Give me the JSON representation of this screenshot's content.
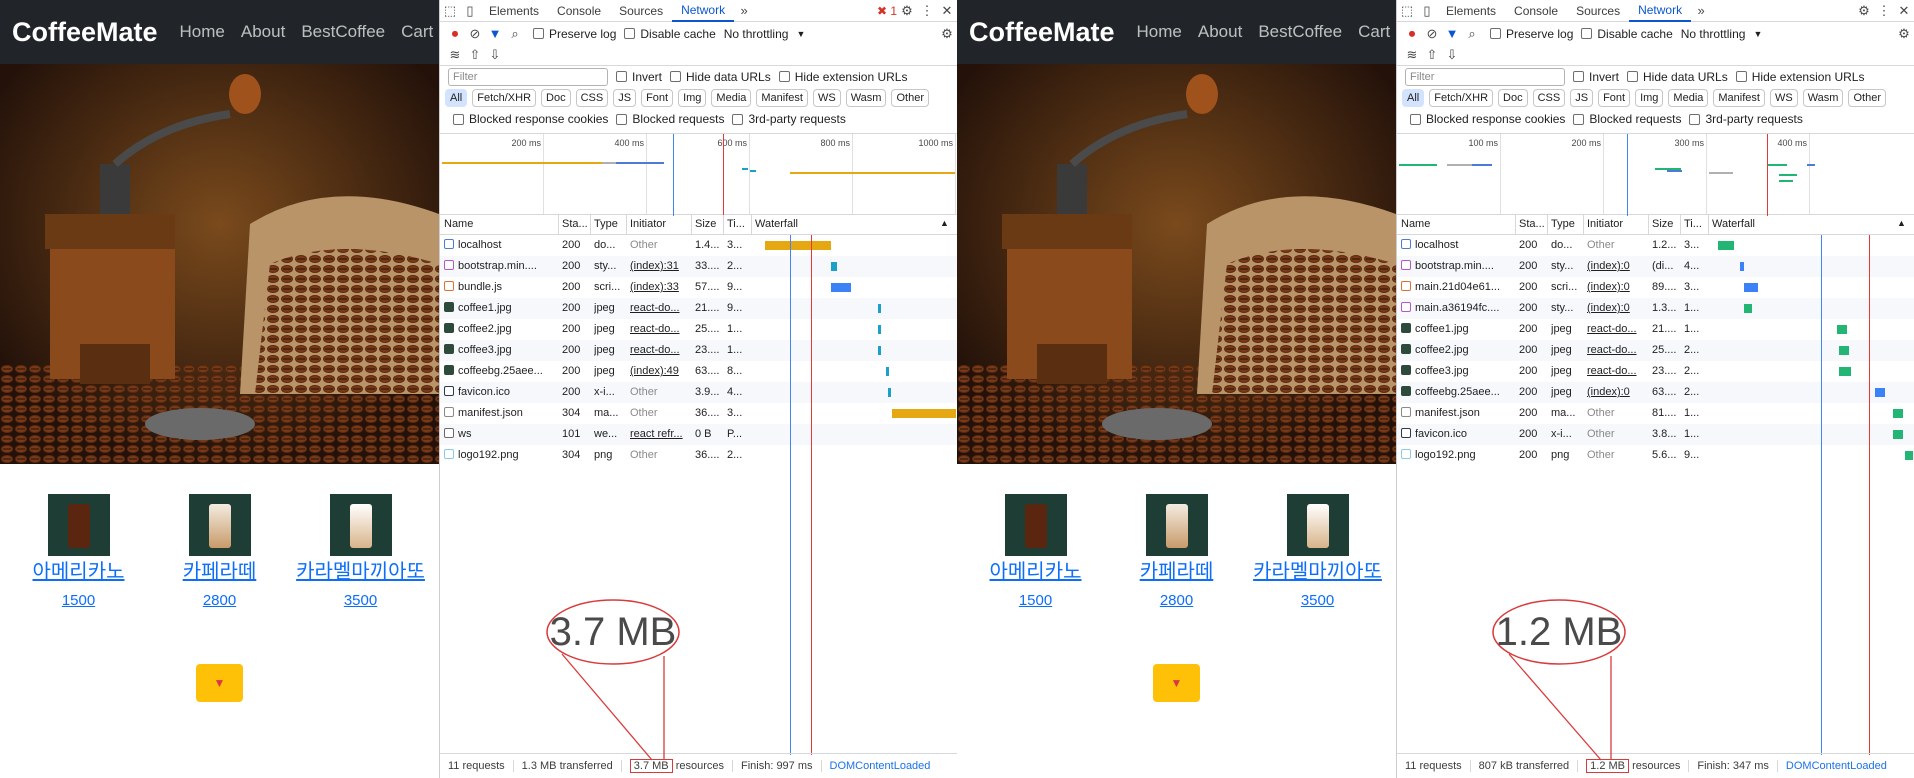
{
  "left": {
    "app": {
      "brand": "CoffeeMate",
      "nav": [
        "Home",
        "About",
        "BestCoffee",
        "Cart"
      ],
      "products": [
        {
          "name": "아메리카노",
          "price": "1500"
        },
        {
          "name": "카페라떼",
          "price": "2800"
        },
        {
          "name": "카라멜마끼아또",
          "price": "3500"
        }
      ]
    },
    "devtools": {
      "tabs": [
        "Elements",
        "Console",
        "Sources",
        "Network"
      ],
      "error_count": "1",
      "preserve_log": "Preserve log",
      "disable_cache": "Disable cache",
      "throttling": "No throttling",
      "filter_placeholder": "Filter",
      "invert": "Invert",
      "hide_data_urls": "Hide data URLs",
      "hide_ext_urls": "Hide extension URLs",
      "types": [
        "All",
        "Fetch/XHR",
        "Doc",
        "CSS",
        "JS",
        "Font",
        "Img",
        "Media",
        "Manifest",
        "WS",
        "Wasm",
        "Other"
      ],
      "blocked_cookies": "Blocked response cookies",
      "blocked_requests": "Blocked requests",
      "third_party": "3rd-party requests",
      "ticks": [
        "200 ms",
        "400 ms",
        "600 ms",
        "800 ms",
        "1000 ms"
      ],
      "columns": [
        "Name",
        "Sta...",
        "Type",
        "Initiator",
        "Size",
        "Ti...",
        "Waterfall"
      ],
      "rows": [
        {
          "icon": "doc",
          "name": "localhost",
          "status": "200",
          "type": "do...",
          "initiator": "Other",
          "init_link": false,
          "size": "1.4...",
          "time": "3...",
          "wf_start": 0.05,
          "wf_len": 0.33,
          "wf_color": "#e5a812"
        },
        {
          "icon": "css",
          "name": "bootstrap.min....",
          "status": "200",
          "type": "sty...",
          "initiator": "(index):31",
          "init_link": true,
          "size": "33....",
          "time": "2...",
          "wf_start": 0.38,
          "wf_len": 0.03,
          "wf_color": "#1ba0c9"
        },
        {
          "icon": "js",
          "name": "bundle.js",
          "status": "200",
          "type": "scri...",
          "initiator": "(index):33",
          "init_link": true,
          "size": "57....",
          "time": "9...",
          "wf_start": 0.38,
          "wf_len": 0.1,
          "wf_color": "#3b82f6"
        },
        {
          "icon": "img",
          "name": "coffee1.jpg",
          "status": "200",
          "type": "jpeg",
          "initiator": "react-do...",
          "init_link": true,
          "size": "21....",
          "time": "9...",
          "wf_start": 0.61,
          "wf_len": 0.015,
          "wf_color": "#1ba0c9"
        },
        {
          "icon": "img",
          "name": "coffee2.jpg",
          "status": "200",
          "type": "jpeg",
          "initiator": "react-do...",
          "init_link": true,
          "size": "25....",
          "time": "1...",
          "wf_start": 0.61,
          "wf_len": 0.015,
          "wf_color": "#1ba0c9"
        },
        {
          "icon": "img",
          "name": "coffee3.jpg",
          "status": "200",
          "type": "jpeg",
          "initiator": "react-do...",
          "init_link": true,
          "size": "23....",
          "time": "1...",
          "wf_start": 0.61,
          "wf_len": 0.015,
          "wf_color": "#1ba0c9"
        },
        {
          "icon": "img",
          "name": "coffeebg.25aee...",
          "status": "200",
          "type": "jpeg",
          "initiator": "(index):49",
          "init_link": true,
          "size": "63....",
          "time": "8...",
          "wf_start": 0.65,
          "wf_len": 0.015,
          "wf_color": "#1ba0c9"
        },
        {
          "icon": "ico",
          "name": "favicon.ico",
          "status": "200",
          "type": "x-i...",
          "initiator": "Other",
          "init_link": false,
          "size": "3.9...",
          "time": "4...",
          "wf_start": 0.66,
          "wf_len": 0.015,
          "wf_color": "#1ba0c9"
        },
        {
          "icon": "man",
          "name": "manifest.json",
          "status": "304",
          "type": "ma...",
          "initiator": "Other",
          "init_link": false,
          "size": "36....",
          "time": "3...",
          "wf_start": 0.68,
          "wf_len": 0.32,
          "wf_color": "#e5a812"
        },
        {
          "icon": "ws",
          "name": "ws",
          "status": "101",
          "type": "we...",
          "initiator": "react refr...",
          "init_link": true,
          "size": "0 B",
          "time": "P...",
          "wf_start": 0,
          "wf_len": 0,
          "wf_color": "#e5a812"
        },
        {
          "icon": "png",
          "name": "logo192.png",
          "status": "304",
          "type": "png",
          "initiator": "Other",
          "init_link": false,
          "size": "36....",
          "time": "2...",
          "wf_start": 0,
          "wf_len": 0,
          "wf_color": "#e5a812"
        }
      ],
      "requests": "11 requests",
      "transferred": "1.3 MB transferred",
      "resources_value": "3.7 MB",
      "resources_label": "resources",
      "finish": "Finish: 997 ms",
      "dcl": "DOMContentLoaded",
      "callout": "3.7 MB"
    }
  },
  "right": {
    "app": {
      "brand": "CoffeeMate",
      "nav": [
        "Home",
        "About",
        "BestCoffee",
        "Cart"
      ],
      "products": [
        {
          "name": "아메리카노",
          "price": "1500"
        },
        {
          "name": "카페라떼",
          "price": "2800"
        },
        {
          "name": "카라멜마끼아또",
          "price": "3500"
        }
      ]
    },
    "devtools": {
      "tabs": [
        "Elements",
        "Console",
        "Sources",
        "Network"
      ],
      "preserve_log": "Preserve log",
      "disable_cache": "Disable cache",
      "throttling": "No throttling",
      "filter_placeholder": "Filter",
      "invert": "Invert",
      "hide_data_urls": "Hide data URLs",
      "hide_ext_urls": "Hide extension URLs",
      "types": [
        "All",
        "Fetch/XHR",
        "Doc",
        "CSS",
        "JS",
        "Font",
        "Img",
        "Media",
        "Manifest",
        "WS",
        "Wasm",
        "Other"
      ],
      "blocked_cookies": "Blocked response cookies",
      "blocked_requests": "Blocked requests",
      "third_party": "3rd-party requests",
      "ticks": [
        "100 ms",
        "200 ms",
        "300 ms",
        "400 ms"
      ],
      "columns": [
        "Name",
        "Sta...",
        "Type",
        "Initiator",
        "Size",
        "Ti...",
        "Waterfall"
      ],
      "rows": [
        {
          "icon": "doc",
          "name": "localhost",
          "status": "200",
          "type": "do...",
          "initiator": "Other",
          "init_link": false,
          "size": "1.2...",
          "time": "3...",
          "wf_start": 0.03,
          "wf_len": 0.08,
          "wf_color": "#22b573"
        },
        {
          "icon": "css",
          "name": "bootstrap.min....",
          "status": "200",
          "type": "sty...",
          "initiator": "(index):0",
          "init_link": true,
          "size": "(di...",
          "time": "4...",
          "wf_start": 0.14,
          "wf_len": 0.02,
          "wf_color": "#3b82f6"
        },
        {
          "icon": "js",
          "name": "main.21d04e61...",
          "status": "200",
          "type": "scri...",
          "initiator": "(index):0",
          "init_link": true,
          "size": "89....",
          "time": "3...",
          "wf_start": 0.16,
          "wf_len": 0.07,
          "wf_color": "#3b82f6"
        },
        {
          "icon": "css",
          "name": "main.a36194fc....",
          "status": "200",
          "type": "sty...",
          "initiator": "(index):0",
          "init_link": true,
          "size": "1.3...",
          "time": "1...",
          "wf_start": 0.16,
          "wf_len": 0.04,
          "wf_color": "#22b573"
        },
        {
          "icon": "img",
          "name": "coffee1.jpg",
          "status": "200",
          "type": "jpeg",
          "initiator": "react-do...",
          "init_link": true,
          "size": "21....",
          "time": "1...",
          "wf_start": 0.62,
          "wf_len": 0.05,
          "wf_color": "#22b573"
        },
        {
          "icon": "img",
          "name": "coffee2.jpg",
          "status": "200",
          "type": "jpeg",
          "initiator": "react-do...",
          "init_link": true,
          "size": "25....",
          "time": "2...",
          "wf_start": 0.63,
          "wf_len": 0.05,
          "wf_color": "#22b573"
        },
        {
          "icon": "img",
          "name": "coffee3.jpg",
          "status": "200",
          "type": "jpeg",
          "initiator": "react-do...",
          "init_link": true,
          "size": "23....",
          "time": "2...",
          "wf_start": 0.63,
          "wf_len": 0.06,
          "wf_color": "#22b573"
        },
        {
          "icon": "img",
          "name": "coffeebg.25aee...",
          "status": "200",
          "type": "jpeg",
          "initiator": "(index):0",
          "init_link": true,
          "size": "63....",
          "time": "2...",
          "wf_start": 0.81,
          "wf_len": 0.05,
          "wf_color": "#3b82f6"
        },
        {
          "icon": "man",
          "name": "manifest.json",
          "status": "200",
          "type": "ma...",
          "initiator": "Other",
          "init_link": false,
          "size": "81....",
          "time": "1...",
          "wf_start": 0.9,
          "wf_len": 0.05,
          "wf_color": "#22b573"
        },
        {
          "icon": "ico",
          "name": "favicon.ico",
          "status": "200",
          "type": "x-i...",
          "initiator": "Other",
          "init_link": false,
          "size": "3.8...",
          "time": "1...",
          "wf_start": 0.9,
          "wf_len": 0.05,
          "wf_color": "#22b573"
        },
        {
          "icon": "png",
          "name": "logo192.png",
          "status": "200",
          "type": "png",
          "initiator": "Other",
          "init_link": false,
          "size": "5.6...",
          "time": "9...",
          "wf_start": 0.96,
          "wf_len": 0.04,
          "wf_color": "#22b573"
        }
      ],
      "requests": "11 requests",
      "transferred": "807 kB transferred",
      "resources_value": "1.2 MB",
      "resources_label": "resources",
      "finish": "Finish: 347 ms",
      "dcl": "DOMContentLoaded",
      "callout": "1.2 MB"
    }
  },
  "colors": {
    "navbar": "#212529",
    "link": "#0d6efd",
    "cart_button": "#ffc107",
    "callout": "#d93a3a",
    "active_tab": "#0b57d0"
  }
}
